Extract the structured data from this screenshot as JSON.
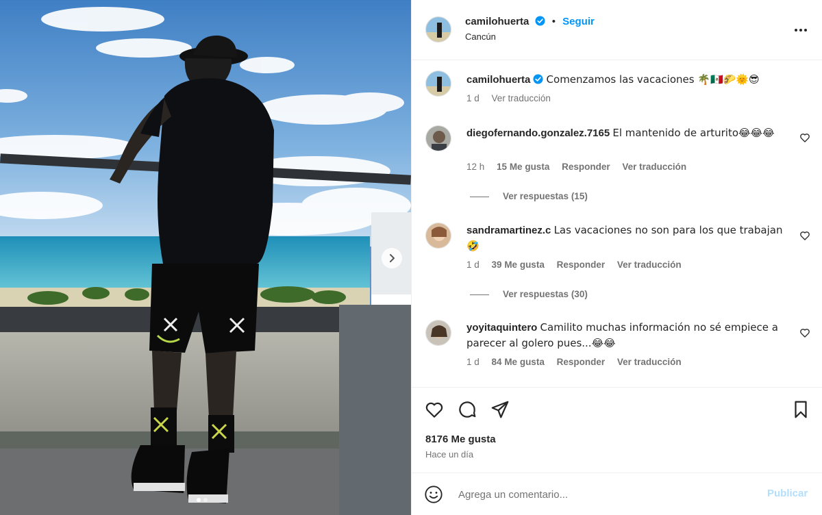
{
  "post": {
    "username": "camilohuerta",
    "follow_label": "Seguir",
    "separator": "•",
    "location": "Cancún"
  },
  "caption": {
    "username": "camilohuerta",
    "text": "Comenzamos las vacaciones 🌴🇲🇽🌮🌞😎",
    "time": "1 d",
    "translate_label": "Ver traducción"
  },
  "comments": [
    {
      "username": "diegofernando.gonzalez.7165",
      "text": "El mantenido de arturito😂😂😂",
      "time": "12 h",
      "likes": "15 Me gusta",
      "reply_label": "Responder",
      "translate_label": "Ver traducción",
      "replies_label": "Ver respuestas (15)"
    },
    {
      "username": "sandramartinez.c",
      "text": "Las vacaciones no son para los que trabajan 🤣",
      "time": "1 d",
      "likes": "39 Me gusta",
      "reply_label": "Responder",
      "translate_label": "Ver traducción",
      "replies_label": "Ver respuestas (30)"
    },
    {
      "username": "yoyitaquintero",
      "text": "Camilito muchas información no sé empiece a parecer al golero pues...😂😂",
      "time": "1 d",
      "likes": "84 Me gusta",
      "reply_label": "Responder",
      "translate_label": "Ver traducción"
    }
  ],
  "footer": {
    "likes_count": "8176 Me gusta",
    "posted_ago": "Hace un día"
  },
  "add_comment": {
    "placeholder": "Agrega un comentario...",
    "post_label": "Publicar"
  },
  "carousel": {
    "current_slide": 1,
    "total_slides": 2
  },
  "colors": {
    "accent": "#0095f6",
    "post_disabled": "#b2dffc",
    "muted": "#737373",
    "text": "#262626",
    "verified": "#0095f6"
  },
  "icons": [
    "more-icon",
    "verified-icon",
    "heart-icon",
    "comment-icon",
    "share-icon",
    "bookmark-icon",
    "smile-icon",
    "chevron-right-icon"
  ]
}
